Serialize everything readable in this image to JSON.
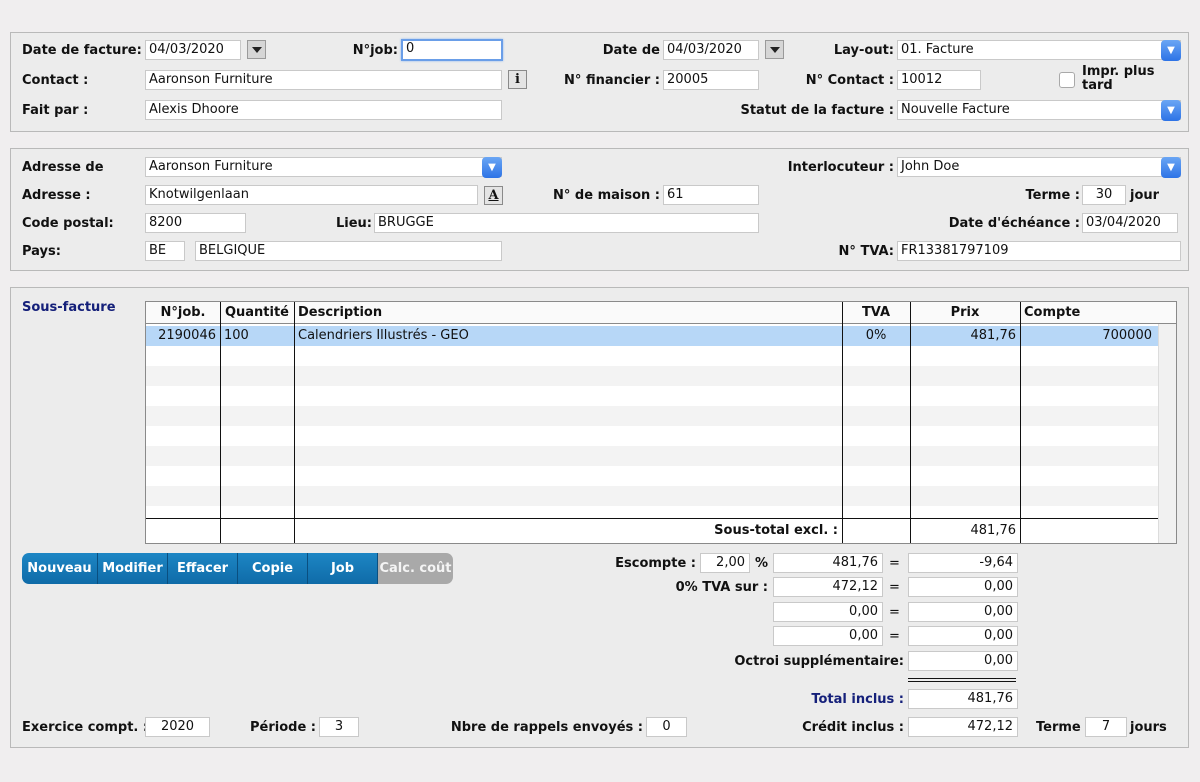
{
  "header": {
    "date_facture_label": "Date de facture:",
    "date_facture": "04/03/2020",
    "njob_label": "N°job:",
    "njob": "0",
    "date_de_label": "Date de",
    "date_de": "04/03/2020",
    "layout_label": "Lay-out:",
    "layout": "01. Facture",
    "contact_label": "Contact :",
    "contact": "Aaronson Furniture",
    "info_button": "i",
    "nfinancier_label": "N° financier :",
    "nfinancier": "20005",
    "ncontact_label": "N° Contact :",
    "ncontact": "10012",
    "impr_label": "Impr. plus tard",
    "fait_par_label": "Fait par :",
    "fait_par": "Alexis Dhoore",
    "statut_label": "Statut de la facture :",
    "statut": "Nouvelle Facture"
  },
  "address": {
    "adresse_de_label": "Adresse de",
    "adresse_de": "Aaronson Furniture",
    "interlocuteur_label": "Interlocuteur :",
    "interlocuteur": "John Doe",
    "adresse_label": "Adresse :",
    "adresse": "Knotwilgenlaan",
    "a_button": "A",
    "nmaison_label": "N° de maison :",
    "nmaison": "61",
    "terme_label": "Terme :",
    "terme": "30",
    "jour_label": "jour",
    "code_postal_label": "Code postal:",
    "code_postal": "8200",
    "lieu_label": "Lieu:",
    "lieu": "BRUGGE",
    "echeance_label": "Date d'échéance :",
    "echeance": "03/04/2020",
    "pays_label": "Pays:",
    "pays_code": "BE",
    "pays": "BELGIQUE",
    "tva_label": "N° TVA:",
    "tva": "FR13381797109"
  },
  "sous_facture": {
    "title": "Sous-facture",
    "columns": [
      "N°job.",
      "Quantité",
      "Description",
      "TVA",
      "Prix",
      "Compte"
    ],
    "rows": [
      {
        "njob": "2190046",
        "qty": "100",
        "desc": "Calendriers Illustrés - GEO",
        "tva": "0%",
        "prix": "481,76",
        "compte": "700000"
      }
    ],
    "subtotal_label": "Sous-total excl. :",
    "subtotal": "481,76"
  },
  "buttons": {
    "nouveau": "Nouveau",
    "modifier": "Modifier",
    "effacer": "Effacer",
    "copie": "Copie",
    "job": "Job",
    "calc": "Calc. coût"
  },
  "totals": {
    "escompte_label": "Escompte :",
    "escompte_pct": "2,00",
    "pct_sign": "%",
    "escompte_base": "481,76",
    "escompte_val": "-9,64",
    "tva0_label": "0% TVA sur :",
    "tva0_base": "472,12",
    "tva0_val": "0,00",
    "line3_base": "0,00",
    "line3_val": "0,00",
    "line4_base": "0,00",
    "line4_val": "0,00",
    "eq": "=",
    "octroi_label": "Octroi supplémentaire:",
    "octroi": "0,00",
    "total_label": "Total inclus :",
    "total": "481,76",
    "credit_label": "Crédit inclus :",
    "credit": "472,12",
    "terme_label": "Terme",
    "terme": "7",
    "jours_label": "jours"
  },
  "footer": {
    "exercice_label": "Exercice compt. :",
    "exercice": "2020",
    "periode_label": "Période :",
    "periode": "3",
    "rappels_label": "Nbre de rappels envoyés :",
    "rappels": "0"
  }
}
